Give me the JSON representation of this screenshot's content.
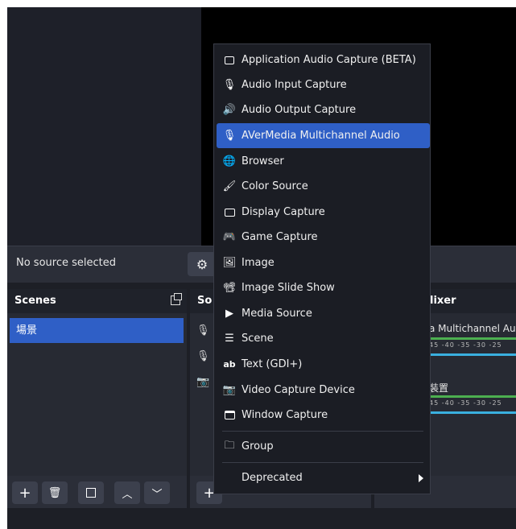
{
  "context_bar": {
    "no_source": "No source selected"
  },
  "scenes": {
    "title": "Scenes",
    "items": [
      "場景"
    ]
  },
  "sources": {
    "title_partial": "So"
  },
  "mixer": {
    "title_partial": "lixer",
    "track1": "a Multichannel Au",
    "scale1": "45 -40 -35 -30 -25",
    "track2": "裝置",
    "scale2": "45 -40 -35 -30 -25"
  },
  "menu": {
    "items": [
      {
        "label": "Application Audio Capture (BETA)",
        "icon": "app-audio-icon"
      },
      {
        "label": "Audio Input Capture",
        "icon": "microphone-icon"
      },
      {
        "label": "Audio Output Capture",
        "icon": "speaker-icon"
      },
      {
        "label": "AVerMedia Multichannel Audio",
        "icon": "microphone-icon",
        "highlighted": true
      },
      {
        "label": "Browser",
        "icon": "globe-icon"
      },
      {
        "label": "Color Source",
        "icon": "brush-icon"
      },
      {
        "label": "Display Capture",
        "icon": "monitor-icon"
      },
      {
        "label": "Game Capture",
        "icon": "gamepad-icon"
      },
      {
        "label": "Image",
        "icon": "image-icon"
      },
      {
        "label": "Image Slide Show",
        "icon": "slideshow-icon"
      },
      {
        "label": "Media Source",
        "icon": "play-icon"
      },
      {
        "label": "Scene",
        "icon": "list-icon"
      },
      {
        "label": "Text (GDI+)",
        "icon": "text-icon"
      },
      {
        "label": "Video Capture Device",
        "icon": "camera-icon"
      },
      {
        "label": "Window Capture",
        "icon": "window-icon"
      }
    ],
    "group": "Group",
    "deprecated": "Deprecated"
  },
  "colors": {
    "accent": "#2f5fc6",
    "bg": "#1d1f26",
    "menu_bg": "#1b1d24"
  }
}
